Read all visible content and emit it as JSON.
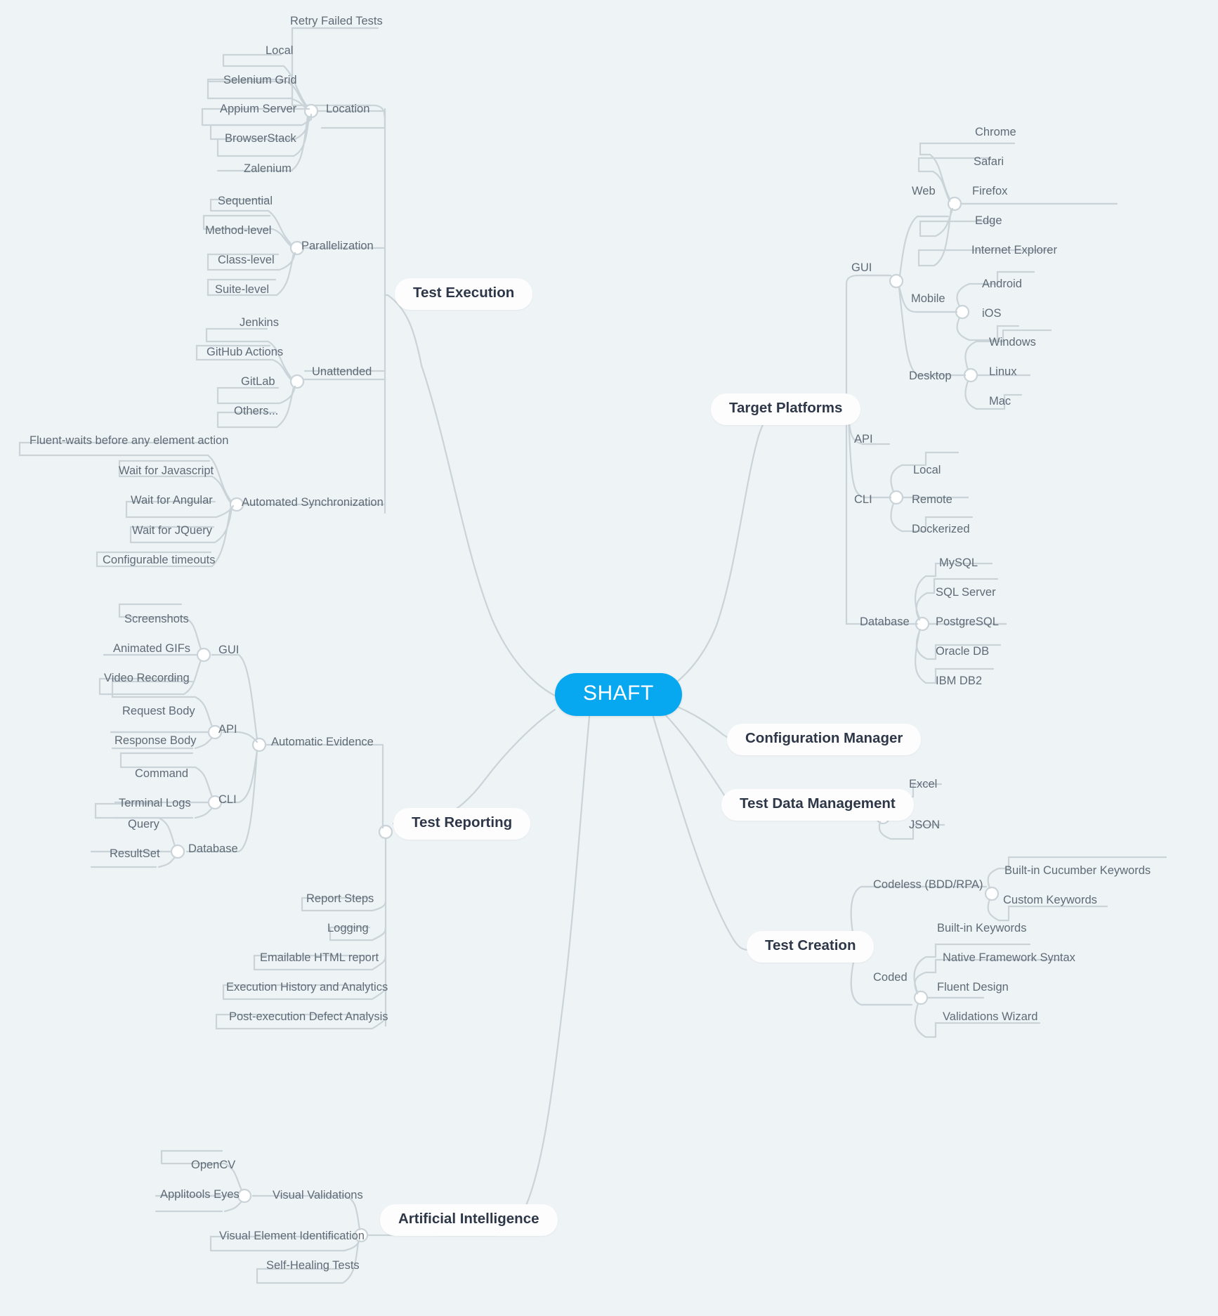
{
  "theme": {
    "background": "#eef3f6",
    "root_fill": "#07a8f0",
    "root_text": "#ffffff",
    "pill_fill": "#fdfdfd",
    "pill_text": "#2d3748",
    "label_text": "#5f6b76",
    "wire": "#c9d3d8"
  },
  "root": {
    "label": "SHAFT"
  },
  "branches": [
    {
      "id": "test-execution",
      "label": "Test Execution",
      "side": "left",
      "children": [
        {
          "label": "Retry Failed Tests",
          "children": []
        },
        {
          "label": "Location",
          "children": [
            {
              "label": "Local"
            },
            {
              "label": "Selenium Grid"
            },
            {
              "label": "Appium Server"
            },
            {
              "label": "BrowserStack"
            },
            {
              "label": "Zalenium"
            }
          ]
        },
        {
          "label": "Parallelization",
          "children": [
            {
              "label": "Sequential"
            },
            {
              "label": "Method-level"
            },
            {
              "label": "Class-level"
            },
            {
              "label": "Suite-level"
            }
          ]
        },
        {
          "label": "Unattended",
          "children": [
            {
              "label": "Jenkins"
            },
            {
              "label": "GitHub Actions"
            },
            {
              "label": "GitLab"
            },
            {
              "label": "Others..."
            }
          ]
        },
        {
          "label": "Automated Synchronization",
          "children": [
            {
              "label": "Fluent-waits before any element action"
            },
            {
              "label": "Wait for Javascript"
            },
            {
              "label": "Wait for Angular"
            },
            {
              "label": "Wait for JQuery"
            },
            {
              "label": "Configurable timeouts"
            }
          ]
        }
      ]
    },
    {
      "id": "target-platforms",
      "label": "Target Platforms",
      "side": "right",
      "children": [
        {
          "label": "GUI",
          "children": [
            {
              "label": "Web",
              "children": [
                {
                  "label": "Chrome"
                },
                {
                  "label": "Safari"
                },
                {
                  "label": "Firefox"
                },
                {
                  "label": "Edge"
                },
                {
                  "label": "Internet Explorer"
                }
              ]
            },
            {
              "label": "Mobile",
              "children": [
                {
                  "label": "Android"
                },
                {
                  "label": "iOS"
                }
              ]
            },
            {
              "label": "Desktop",
              "children": [
                {
                  "label": "Windows"
                },
                {
                  "label": "Linux"
                },
                {
                  "label": "Mac"
                }
              ]
            }
          ]
        },
        {
          "label": "API",
          "children": []
        },
        {
          "label": "CLI",
          "children": [
            {
              "label": "Local"
            },
            {
              "label": "Remote"
            },
            {
              "label": "Dockerized"
            }
          ]
        },
        {
          "label": "Database",
          "children": [
            {
              "label": "MySQL"
            },
            {
              "label": "SQL Server"
            },
            {
              "label": "PostgreSQL"
            },
            {
              "label": "Oracle DB"
            },
            {
              "label": "IBM DB2"
            }
          ]
        }
      ]
    },
    {
      "id": "configuration-manager",
      "label": "Configuration Manager",
      "side": "right",
      "children": []
    },
    {
      "id": "test-data-management",
      "label": "Test Data Management",
      "side": "right",
      "children": [
        {
          "label": "Excel"
        },
        {
          "label": "JSON"
        }
      ]
    },
    {
      "id": "test-creation",
      "label": "Test Creation",
      "side": "right",
      "children": [
        {
          "label": "Codeless (BDD/RPA)",
          "children": [
            {
              "label": "Built-in Cucumber Keywords"
            },
            {
              "label": "Custom Keywords"
            }
          ]
        },
        {
          "label": "Coded",
          "children": [
            {
              "label": "Built-in Keywords"
            },
            {
              "label": "Native Framework Syntax"
            },
            {
              "label": "Fluent Design"
            },
            {
              "label": "Validations Wizard"
            }
          ]
        }
      ]
    },
    {
      "id": "test-reporting",
      "label": "Test Reporting",
      "side": "left",
      "children": [
        {
          "label": "Automatic Evidence",
          "children": [
            {
              "label": "GUI",
              "children": [
                {
                  "label": "Screenshots"
                },
                {
                  "label": "Animated GIFs"
                },
                {
                  "label": "Video Recording"
                }
              ]
            },
            {
              "label": "API",
              "children": [
                {
                  "label": "Request Body"
                },
                {
                  "label": "Response Body"
                }
              ]
            },
            {
              "label": "CLI",
              "children": [
                {
                  "label": "Command"
                },
                {
                  "label": "Terminal Logs"
                }
              ]
            },
            {
              "label": "Database",
              "children": [
                {
                  "label": "Query"
                },
                {
                  "label": "ResultSet"
                }
              ]
            }
          ]
        },
        {
          "label": "Report Steps"
        },
        {
          "label": "Logging"
        },
        {
          "label": "Emailable HTML report"
        },
        {
          "label": "Execution History and Analytics"
        },
        {
          "label": "Post-execution Defect Analysis"
        }
      ]
    },
    {
      "id": "artificial-intelligence",
      "label": "Artificial Intelligence",
      "side": "left",
      "children": [
        {
          "label": "Visual Validations",
          "children": [
            {
              "label": "OpenCV"
            },
            {
              "label": "Applitools Eyes"
            }
          ]
        },
        {
          "label": "Visual Element Identification"
        },
        {
          "label": "Self-Healing Tests"
        }
      ]
    }
  ],
  "labels": {
    "retry_failed_tests": "Retry Failed Tests",
    "location": "Location",
    "local_exec": "Local",
    "selenium_grid": "Selenium Grid",
    "appium_server": "Appium Server",
    "browserstack": "BrowserStack",
    "zalenium": "Zalenium",
    "parallelization": "Parallelization",
    "sequential": "Sequential",
    "method_level": "Method-level",
    "class_level": "Class-level",
    "suite_level": "Suite-level",
    "unattended": "Unattended",
    "jenkins": "Jenkins",
    "github_actions": "GitHub Actions",
    "gitlab": "GitLab",
    "others": "Others...",
    "automated_sync": "Automated Synchronization",
    "fluent_waits": "Fluent-waits before any element action",
    "wait_js": "Wait for Javascript",
    "wait_angular": "Wait for Angular",
    "wait_jquery": "Wait for JQuery",
    "configurable_timeouts": "Configurable timeouts",
    "gui": "GUI",
    "web": "Web",
    "chrome": "Chrome",
    "safari": "Safari",
    "firefox": "Firefox",
    "edge": "Edge",
    "ie": "Internet Explorer",
    "mobile": "Mobile",
    "android": "Android",
    "ios": "iOS",
    "desktop": "Desktop",
    "windows": "Windows",
    "linux": "Linux",
    "mac": "Mac",
    "api": "API",
    "cli": "CLI",
    "cli_local": "Local",
    "cli_remote": "Remote",
    "cli_dockerized": "Dockerized",
    "database": "Database",
    "mysql": "MySQL",
    "sqlserver": "SQL Server",
    "postgresql": "PostgreSQL",
    "oracledb": "Oracle DB",
    "ibmdb2": "IBM DB2",
    "excel": "Excel",
    "json": "JSON",
    "codeless": "Codeless (BDD/RPA)",
    "cucumber_keywords": "Built-in Cucumber Keywords",
    "custom_keywords": "Custom Keywords",
    "coded": "Coded",
    "builtin_keywords": "Built-in Keywords",
    "native_syntax": "Native Framework Syntax",
    "fluent_design": "Fluent Design",
    "validations_wizard": "Validations Wizard",
    "screenshots": "Screenshots",
    "animated_gifs": "Animated GIFs",
    "video_recording": "Video Recording",
    "rep_gui": "GUI",
    "request_body": "Request Body",
    "response_body": "Response Body",
    "rep_api": "API",
    "command": "Command",
    "terminal_logs": "Terminal Logs",
    "rep_cli": "CLI",
    "query": "Query",
    "resultset": "ResultSet",
    "rep_database": "Database",
    "automatic_evidence": "Automatic Evidence",
    "report_steps": "Report Steps",
    "logging": "Logging",
    "emailable_html": "Emailable HTML report",
    "exec_history": "Execution History and Analytics",
    "post_defect": "Post-execution Defect Analysis",
    "opencv": "OpenCV",
    "applitools": "Applitools Eyes",
    "visual_validations": "Visual Validations",
    "visual_element_id": "Visual Element Identification",
    "self_healing": "Self-Healing Tests"
  }
}
